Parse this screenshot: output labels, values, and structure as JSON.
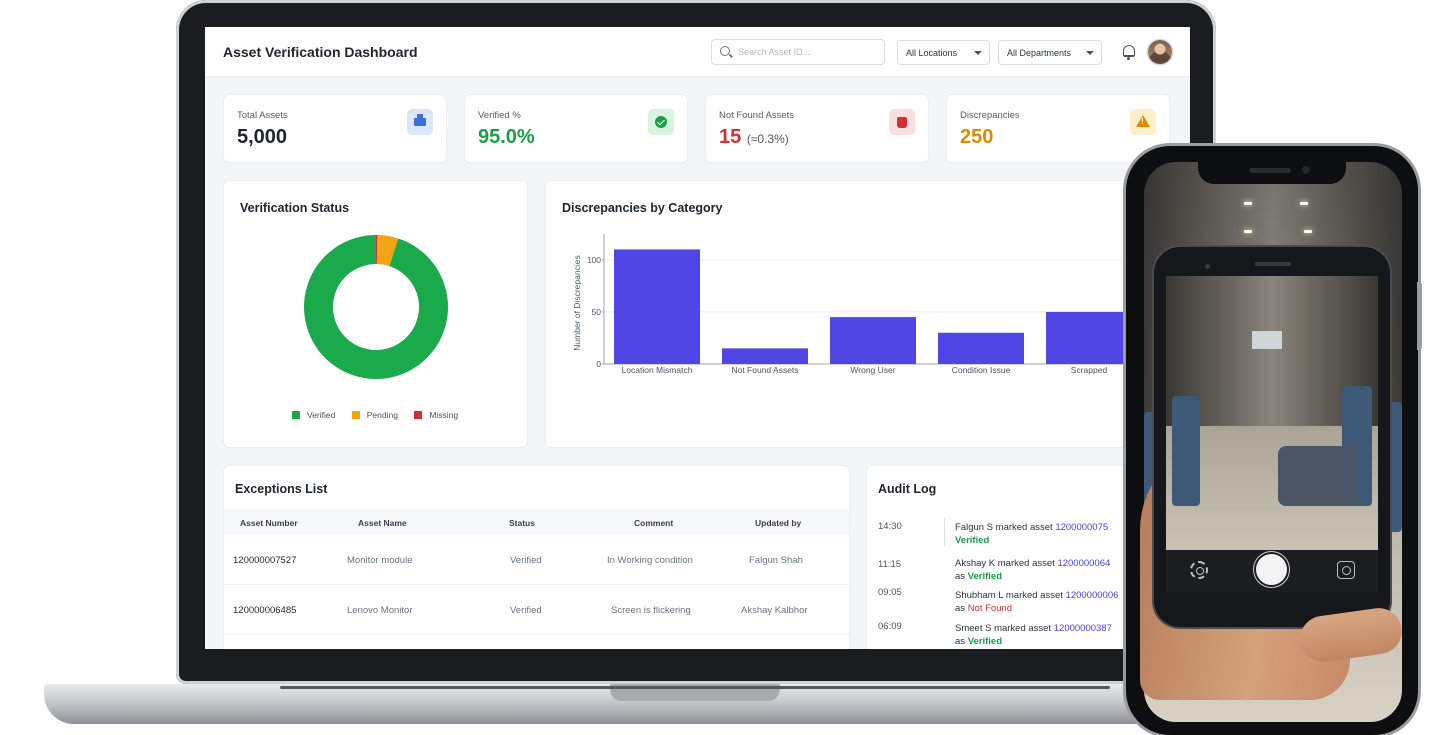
{
  "header": {
    "title": "Asset Verification Dashboard",
    "search_placeholder": "Search Asset ID...",
    "location_filter": "All Locations",
    "department_filter": "All Departments"
  },
  "kpis": [
    {
      "label": "Total Assets",
      "value": "5,000",
      "icon": "building-icon",
      "color": "#3b6fd8"
    },
    {
      "label": "Verified %",
      "value": "95.0%",
      "icon": "check-circle-icon",
      "color": "#1a9e49"
    },
    {
      "label": "Not Found Assets",
      "value": "15",
      "sub": "(≈0.3%)",
      "icon": "trash-icon",
      "color": "#d92d35"
    },
    {
      "label": "Discrepancies",
      "value": "250",
      "icon": "warning-icon",
      "color": "#e08a00"
    }
  ],
  "verification_status": {
    "title": "Verification Status",
    "legend": [
      "Verified",
      "Pending",
      "Missing"
    ]
  },
  "discrepancies": {
    "title": "Discrepancies by Category"
  },
  "chart_data": [
    {
      "type": "pie",
      "title": "Verification Status",
      "categories": [
        "Verified",
        "Pending",
        "Missing"
      ],
      "values": [
        95.0,
        4.7,
        0.3
      ],
      "colors": [
        "#1aaa4b",
        "#f2a413",
        "#d92d35"
      ],
      "legend": "bottom"
    },
    {
      "type": "bar",
      "title": "Discrepancies by Category",
      "categories": [
        "Location Mismatch",
        "Not Found Assets",
        "Wrong User",
        "Condition Issue",
        "Scrapped"
      ],
      "values": [
        110,
        15,
        45,
        30,
        50
      ],
      "ylabel": "Number of Discrepancies",
      "yticks": [
        0,
        50,
        100
      ],
      "ylim": [
        0,
        120
      ],
      "color": "#4f46e5",
      "grid": true
    }
  ],
  "exceptions": {
    "title": "Exceptions List",
    "columns": [
      "Asset Number",
      "Asset Name",
      "Status",
      "Comment",
      "Updated by"
    ],
    "rows": [
      [
        "120000007527",
        "Monitor module",
        "Verified",
        "In Working condition",
        "Falgun Shah"
      ],
      [
        "120000006485",
        "Lenovo Monitor",
        "Verified",
        "Screen is flickering",
        "Akshay Kalbhor"
      ]
    ]
  },
  "audit": {
    "title": "Audit Log",
    "entries": [
      {
        "time": "14:30",
        "text": "Falgun S marked asset",
        "asset": "1200000075",
        "status": "Verified"
      },
      {
        "time": "11:15",
        "text": "Akshay K marked asset",
        "asset": "1200000064",
        "as": "as",
        "status": "Verified"
      },
      {
        "time": "09:05",
        "text": "Shubham L marked asset",
        "asset": "1200000006",
        "as": "as",
        "status": "Not Found"
      },
      {
        "time": "06:09",
        "text": "Smeet S marked asset",
        "asset": "12000000387",
        "as": "as",
        "status": "Verified"
      }
    ]
  }
}
